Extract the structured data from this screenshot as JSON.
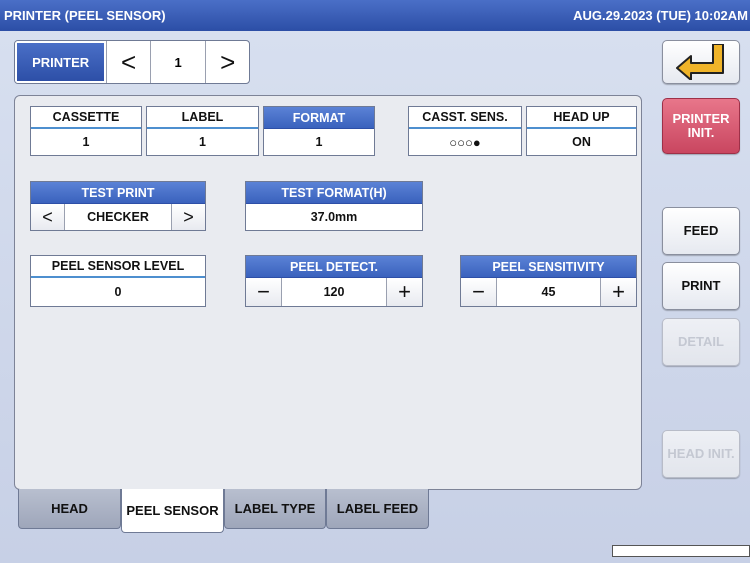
{
  "header": {
    "title": "PRINTER (PEEL SENSOR)",
    "datetime": "AUG.29.2023 (TUE) 10:02AM"
  },
  "printer_selector": {
    "label": "PRINTER",
    "prev": "<",
    "value": "1",
    "next": ">"
  },
  "status_fields": {
    "cassette": {
      "label": "CASSETTE",
      "value": "1"
    },
    "label": {
      "label": "LABEL",
      "value": "1"
    },
    "format": {
      "label": "FORMAT",
      "value": "1"
    },
    "casst_sens": {
      "label": "CASST. SENS.",
      "value": "○○○●"
    },
    "head_up": {
      "label": "HEAD UP",
      "value": "ON"
    }
  },
  "test_print": {
    "label": "TEST PRINT",
    "value": "CHECKER",
    "prev": "<",
    "next": ">"
  },
  "test_format": {
    "label": "TEST FORMAT(H)",
    "value": "37.0mm"
  },
  "peel_sensor_level": {
    "label": "PEEL SENSOR LEVEL",
    "value": "0"
  },
  "peel_detect": {
    "label": "PEEL DETECT.",
    "value": "120",
    "minus": "−",
    "plus": "+"
  },
  "peel_sensitivity": {
    "label": "PEEL SENSITIVITY",
    "value": "45",
    "minus": "−",
    "plus": "+"
  },
  "side_buttons": {
    "printer_init": "PRINTER INIT.",
    "feed": "FEED",
    "print": "PRINT",
    "detail": "DETAIL",
    "head_init": "HEAD INIT."
  },
  "tabs": [
    "HEAD",
    "PEEL SENSOR",
    "LABEL TYPE",
    "LABEL FEED"
  ],
  "colors": {
    "title_bar": "#2c4ea6",
    "accent_blue": "#3a62bd",
    "printer_init": "#c94660"
  }
}
